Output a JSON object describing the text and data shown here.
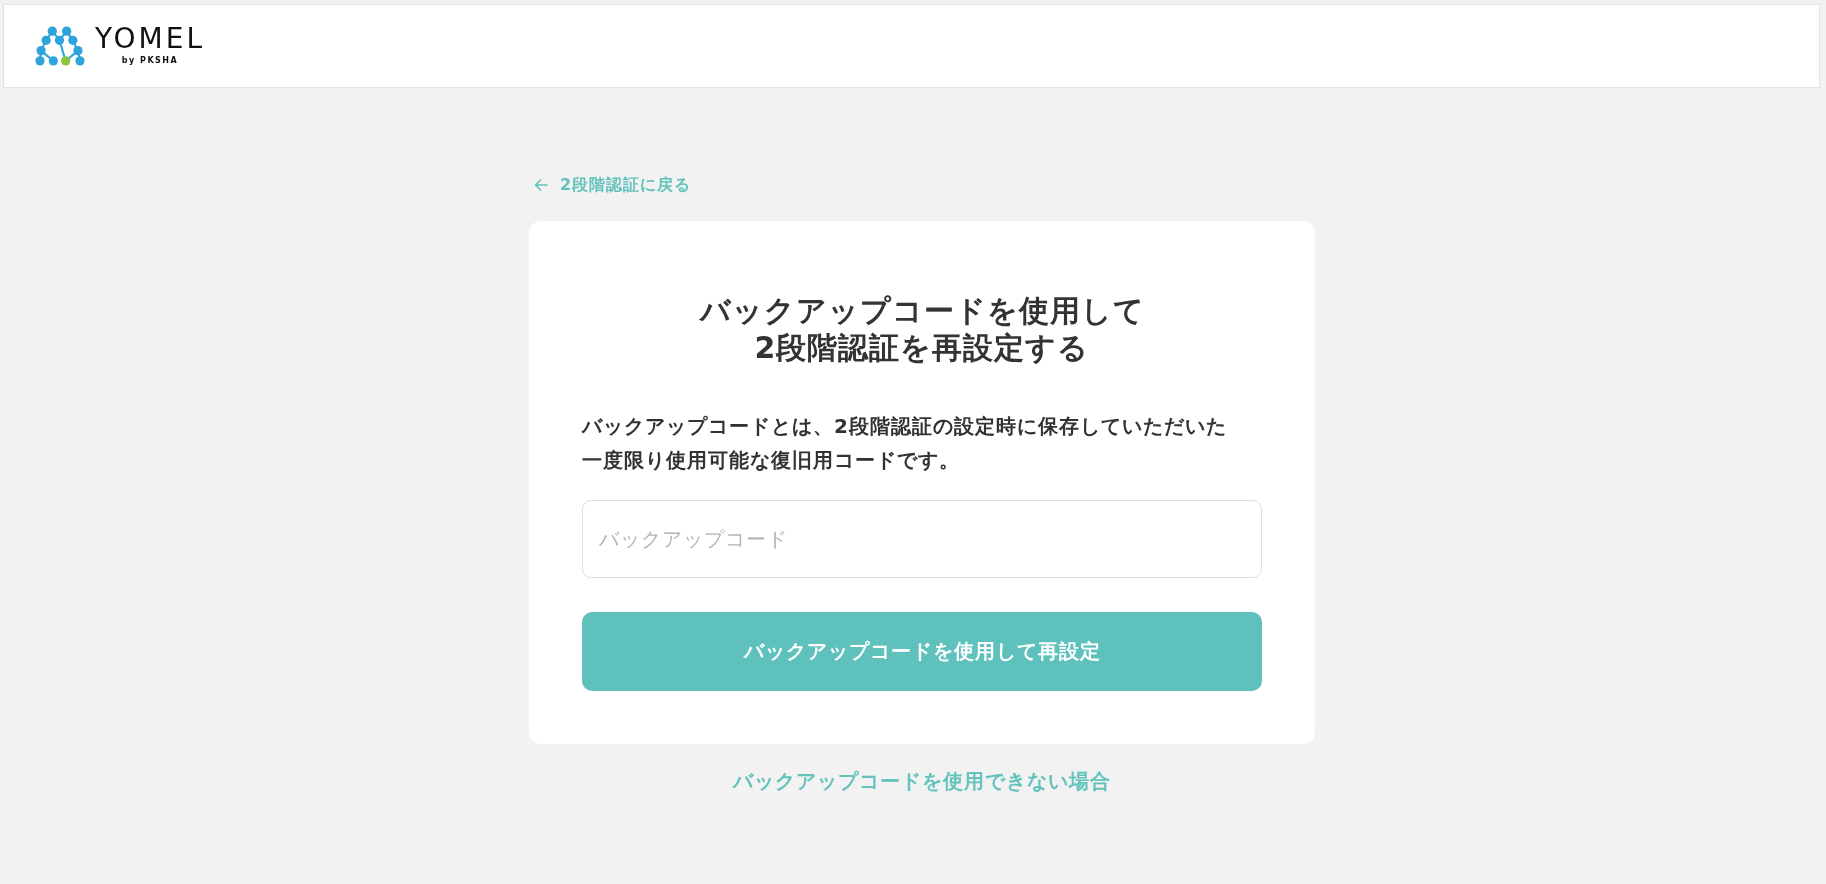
{
  "header": {
    "logo": {
      "wordmark": "YOMEL",
      "tagline": "by PKSHA"
    }
  },
  "back_link": {
    "label": "2段階認証に戻る"
  },
  "card": {
    "title": "バックアップコードを使用して2段階認証を再設定する",
    "description": "バックアップコードとは、2段階認証の設定時に保存していただいた一度限り使用可能な復旧用コードです。",
    "input": {
      "placeholder": "バックアップコード"
    },
    "submit_button": {
      "label": "バックアップコードを使用して再設定"
    }
  },
  "help_link": {
    "label": "バックアップコードを使用できない場合"
  }
}
